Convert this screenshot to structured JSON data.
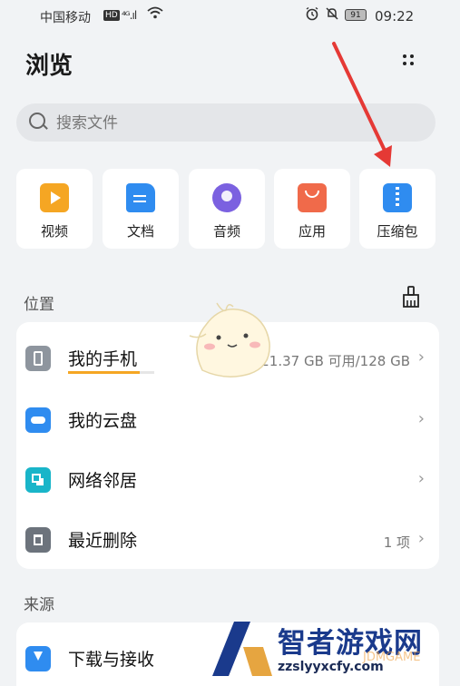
{
  "status_bar": {
    "carrier": "中国移动",
    "hd": "HD",
    "signal": "⁴ᴳ.ıl",
    "battery": "91",
    "time": "09:22"
  },
  "header": {
    "title": "浏览",
    "more_icon": "⋮⋮"
  },
  "search": {
    "placeholder": "搜索文件"
  },
  "categories": [
    {
      "label": "视频",
      "icon": "video-icon",
      "color": "#f5a623"
    },
    {
      "label": "文档",
      "icon": "document-icon",
      "color": "#2f8cf0"
    },
    {
      "label": "音频",
      "icon": "music-icon",
      "color": "#7b61e0"
    },
    {
      "label": "应用",
      "icon": "app-bag-icon",
      "color": "#f06a4a"
    },
    {
      "label": "压缩包",
      "icon": "zip-icon",
      "color": "#2f8cf0"
    }
  ],
  "locations": {
    "heading": "位置",
    "items": [
      {
        "label": "我的手机",
        "value": "21.37 GB 可用/128 GB",
        "icon": "phone-icon",
        "storage_used_fraction": 0.83
      },
      {
        "label": "我的云盘",
        "value": "",
        "icon": "cloud-icon"
      },
      {
        "label": "网络邻居",
        "value": "",
        "icon": "network-icon"
      },
      {
        "label": "最近删除",
        "value": "1 项",
        "icon": "trash-icon"
      }
    ]
  },
  "sources": {
    "heading": "来源",
    "items": [
      {
        "label": "下载与接收",
        "icon": "download-icon"
      }
    ]
  },
  "watermark": {
    "name": "智者游戏网",
    "url": "zzslyyxcfy.com",
    "faint": "JDMGAME"
  },
  "colors": {
    "accent": "#2f8cf0",
    "annotation_arrow": "#e53935"
  }
}
